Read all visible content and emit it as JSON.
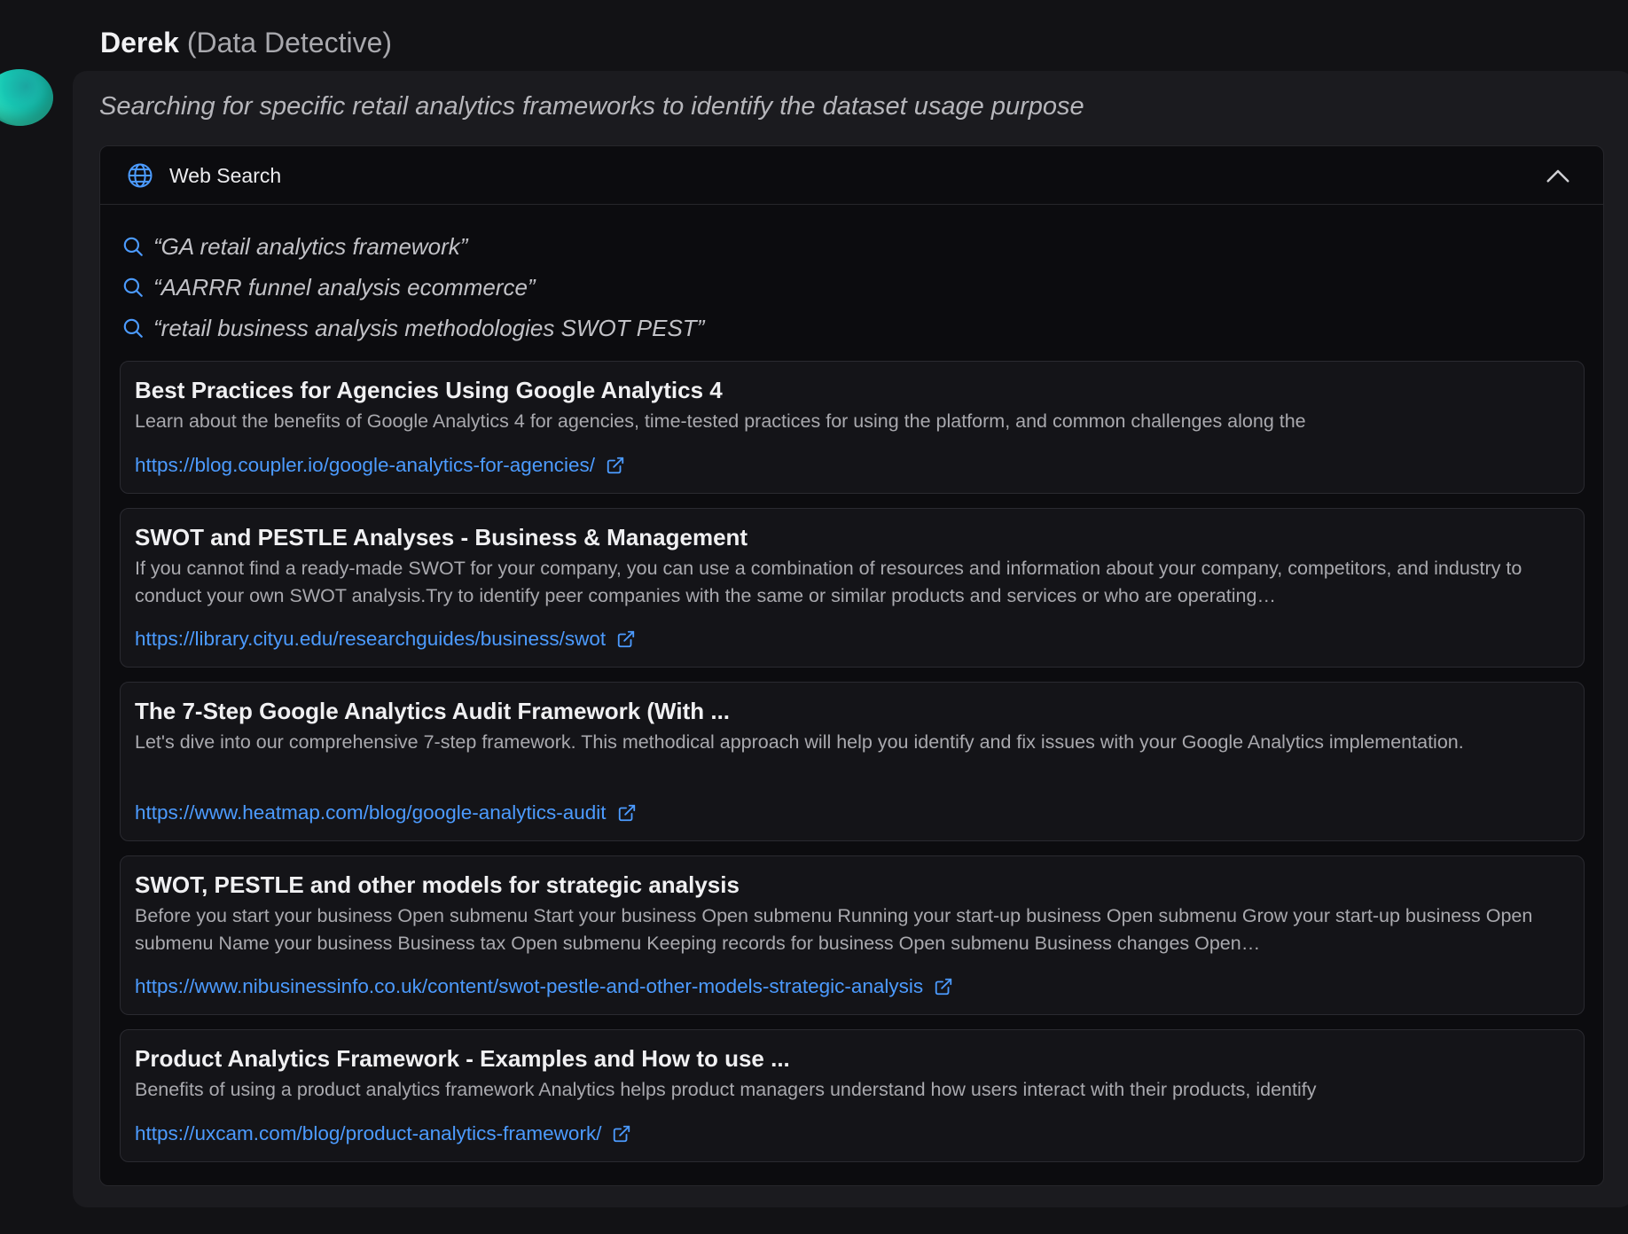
{
  "agent": {
    "name": "Derek",
    "role": "(Data Detective)"
  },
  "thought": "Searching for specific retail analytics frameworks to identify the dataset usage purpose",
  "panel": {
    "title": "Web Search",
    "icon": "globe-icon",
    "collapse_icon": "chevron-up-icon"
  },
  "queries": [
    "“GA retail analytics framework”",
    "“AARRR funnel analysis ecommerce”",
    "“retail business analysis methodologies SWOT PEST”"
  ],
  "results": [
    {
      "title": "Best Practices for Agencies Using Google Analytics 4",
      "snippet": "Learn about the benefits of Google Analytics 4 for agencies, time-tested practices for using the platform, and common challenges along the",
      "url": "https://blog.coupler.io/google-analytics-for-agencies/"
    },
    {
      "title": "SWOT and PESTLE Analyses - Business & Management",
      "snippet": "If you cannot find a ready-made SWOT for your company, you can use a combination of resources and information about your company, competitors, and industry to conduct your own SWOT analysis.Try to identify peer companies with the same or similar products and services or who are operating…",
      "url": "https://library.cityu.edu/researchguides/business/swot"
    },
    {
      "title": "The 7-Step Google Analytics Audit Framework (With ...",
      "snippet": "Let's dive into our comprehensive 7-step framework. This methodical approach will help you identify and fix issues with your Google Analytics implementation.",
      "url": "https://www.heatmap.com/blog/google-analytics-audit"
    },
    {
      "title": "SWOT, PESTLE and other models for strategic analysis",
      "snippet": "Before you start your business Open submenu Start your business Open submenu Running your start-up business Open submenu Grow your start-up business Open submenu Name your business Business tax Open submenu Keeping records for business Open submenu Business changes Open…",
      "url": "https://www.nibusinessinfo.co.uk/content/swot-pestle-and-other-models-strategic-analysis"
    },
    {
      "title": "Product Analytics Framework - Examples and How to use ...",
      "snippet": "Benefits of using a product analytics framework Analytics helps product managers understand how users interact with their products, identify",
      "url": "https://uxcam.com/blog/product-analytics-framework/"
    }
  ],
  "colors": {
    "background": "#121215",
    "bubble": "#1b1b1f",
    "panel": "#0c0c0f",
    "card": "#141418",
    "link": "#4c9bff",
    "accent_icon": "#4c9bff"
  }
}
